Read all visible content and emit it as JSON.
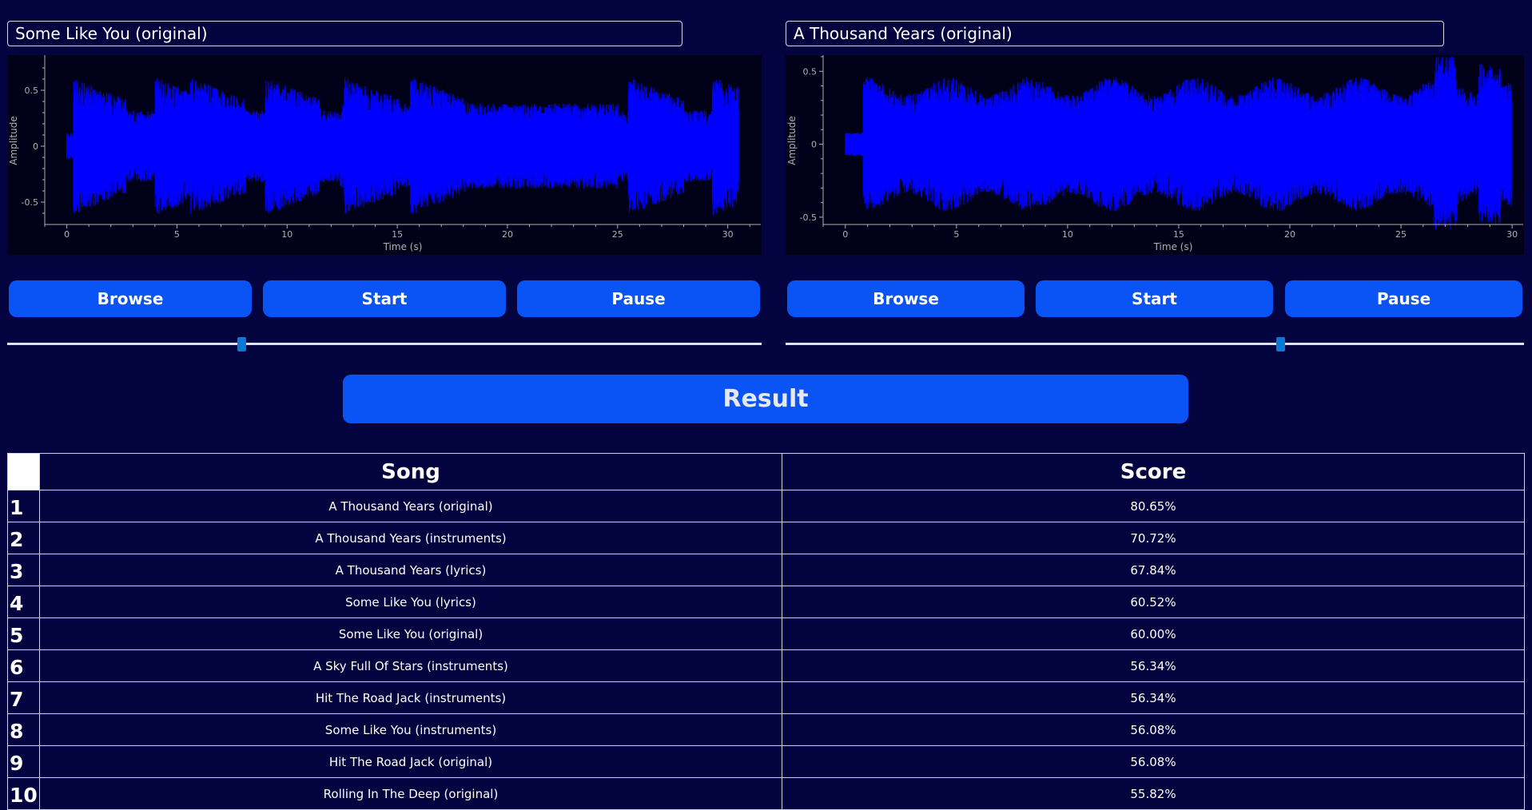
{
  "left": {
    "title": "Some Like You (original)",
    "plot": {
      "ylabel": "Amplitude",
      "xlabel": "Time (s)",
      "xticks": [
        "0",
        "5",
        "10",
        "15",
        "20",
        "25",
        "30"
      ],
      "yticks": [
        "0.5",
        "0",
        "-0.5"
      ],
      "xlim": [
        -1,
        31.5
      ],
      "ylim": [
        -0.7,
        0.8
      ]
    },
    "buttons": {
      "browse": "Browse",
      "start": "Start",
      "pause": "Pause"
    },
    "slider_position": 0.31
  },
  "right": {
    "title": "A Thousand Years (original)",
    "plot": {
      "ylabel": "Amplitude",
      "xlabel": "Time (s)",
      "xticks": [
        "0",
        "5",
        "10",
        "15",
        "20",
        "25",
        "30"
      ],
      "yticks": [
        "0.5",
        "0",
        "-0.5"
      ],
      "xlim": [
        -1,
        30.5
      ],
      "ylim": [
        -0.55,
        0.6
      ]
    },
    "buttons": {
      "browse": "Browse",
      "start": "Start",
      "pause": "Pause"
    },
    "slider_position": 0.67
  },
  "result_label": "Result",
  "table": {
    "headers": [
      "Song",
      "Score"
    ],
    "rows": [
      {
        "index": "1",
        "song": "A Thousand Years (original)",
        "score": "80.65%"
      },
      {
        "index": "2",
        "song": "A Thousand Years (instruments)",
        "score": "70.72%"
      },
      {
        "index": "3",
        "song": "A Thousand Years (lyrics)",
        "score": "67.84%"
      },
      {
        "index": "4",
        "song": "Some Like You (lyrics)",
        "score": "60.52%"
      },
      {
        "index": "5",
        "song": "Some Like You (original)",
        "score": "60.00%"
      },
      {
        "index": "6",
        "song": "A Sky Full Of Stars (instruments)",
        "score": "56.34%"
      },
      {
        "index": "7",
        "song": "Hit The Road Jack (instruments)",
        "score": "56.34%"
      },
      {
        "index": "8",
        "song": "Some Like You (instruments)",
        "score": "56.08%"
      },
      {
        "index": "9",
        "song": "Hit The Road Jack (original)",
        "score": "56.08%"
      },
      {
        "index": "10",
        "song": "Rolling In The Deep (original)",
        "score": "55.82%"
      }
    ]
  },
  "colors": {
    "background": "#03033f",
    "button": "#0a53f5",
    "waveform": "#0000ff",
    "plot_bg": "#000019",
    "axis": "#b0b0b0",
    "slider_handle": "#0a78d6"
  }
}
